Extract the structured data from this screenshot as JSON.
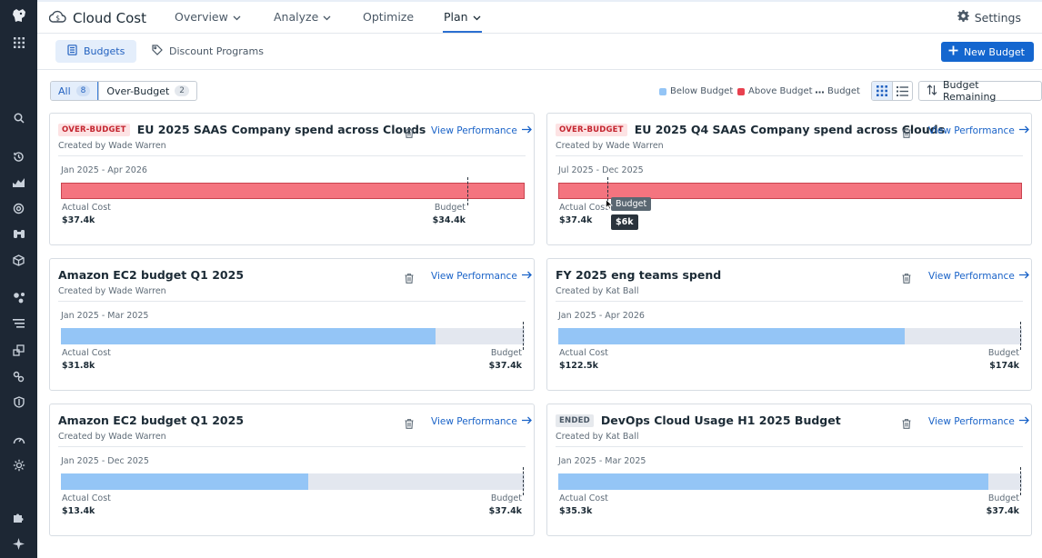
{
  "app": {
    "title": "Cloud Cost"
  },
  "nav": {
    "items": [
      {
        "label": "Overview",
        "has_dropdown": true
      },
      {
        "label": "Analyze",
        "has_dropdown": true
      },
      {
        "label": "Optimize",
        "has_dropdown": false
      },
      {
        "label": "Plan",
        "has_dropdown": true,
        "active": true
      }
    ],
    "settings_label": "Settings"
  },
  "subnav": {
    "tabs": [
      {
        "label": "Budgets",
        "active": true,
        "icon": "budget-icon"
      },
      {
        "label": "Discount Programs",
        "active": false,
        "icon": "tag-icon"
      }
    ],
    "new_button_label": "New Budget"
  },
  "filters": {
    "segments": [
      {
        "label": "All",
        "count": "8",
        "active": true
      },
      {
        "label": "Over-Budget",
        "count": "2",
        "active": false
      }
    ],
    "legend": [
      {
        "label": "Below Budget",
        "color": "#94c5f6"
      },
      {
        "label": "Above Budget",
        "color": "#e8414f"
      },
      {
        "label": "Budget",
        "style": "dotted"
      }
    ],
    "sort_label": "Budget Remaining"
  },
  "cards": [
    {
      "badge": "OVER-BUDGET",
      "badge_type": "over",
      "title": "EU 2025 SAAS Company spend across Clouds",
      "creator": "Created by Wade Warren",
      "period": "Jan 2025 - Apr 2026",
      "actual_label": "Actual Cost",
      "actual": "$37.4k",
      "budget_label": "Budget",
      "budget": "$34.4k",
      "fill_fraction": 1.0,
      "budget_fraction": 0.874,
      "over": true,
      "view_label": "View Performance"
    },
    {
      "badge": "OVER-BUDGET",
      "badge_type": "over",
      "title": "EU 2025 Q4 SAAS Company spend across Clouds",
      "creator": "Created by Wade Warren",
      "period": "Jul 2025 - Dec 2025",
      "actual_label": "Actual Cost",
      "actual": "$37.4k",
      "budget_label": "Budget",
      "budget": "$6k",
      "fill_fraction": 1.0,
      "budget_fraction": 0.104,
      "over": true,
      "view_label": "View Performance",
      "tooltip": {
        "label": "Budget",
        "value": "$6k"
      }
    },
    {
      "badge": "",
      "badge_type": "",
      "title": "Amazon EC2 budget Q1 2025",
      "creator": "Created by Wade Warren",
      "period": "Jan 2025 - Mar 2025",
      "actual_label": "Actual Cost",
      "actual": "$31.8k",
      "budget_label": "Budget",
      "budget": "$37.4k",
      "fill_fraction": 0.808,
      "budget_fraction": 0.996,
      "over": false,
      "view_label": "View Performance"
    },
    {
      "badge": "",
      "badge_type": "",
      "title": "FY 2025 eng teams spend",
      "creator": "Created by Kat Ball",
      "period": "Jan 2025 - Apr 2026",
      "actual_label": "Actual Cost",
      "actual": "$122.5k",
      "budget_label": "Budget",
      "budget": "$174k",
      "fill_fraction": 0.747,
      "budget_fraction": 0.996,
      "over": false,
      "view_label": "View Performance"
    },
    {
      "badge": "",
      "badge_type": "",
      "title": "Amazon EC2 budget Q1 2025",
      "creator": "Created by Wade Warren",
      "period": "Jan 2025 - Dec 2025",
      "actual_label": "Actual Cost",
      "actual": "$13.4k",
      "budget_label": "Budget",
      "budget": "$37.4k",
      "fill_fraction": 0.533,
      "budget_fraction": 0.996,
      "over": false,
      "view_label": "View Performance"
    },
    {
      "badge": "ENDED",
      "badge_type": "ended",
      "title": "DevOps Cloud Usage H1 2025 Budget",
      "creator": "Created by Kat Ball",
      "period": "Jan 2025 - Mar 2025",
      "actual_label": "Actual Cost",
      "actual": "$35.3k",
      "budget_label": "Budget",
      "budget": "$37.4k",
      "fill_fraction": 0.927,
      "budget_fraction": 0.996,
      "over": false,
      "view_label": "View Performance"
    }
  ]
}
